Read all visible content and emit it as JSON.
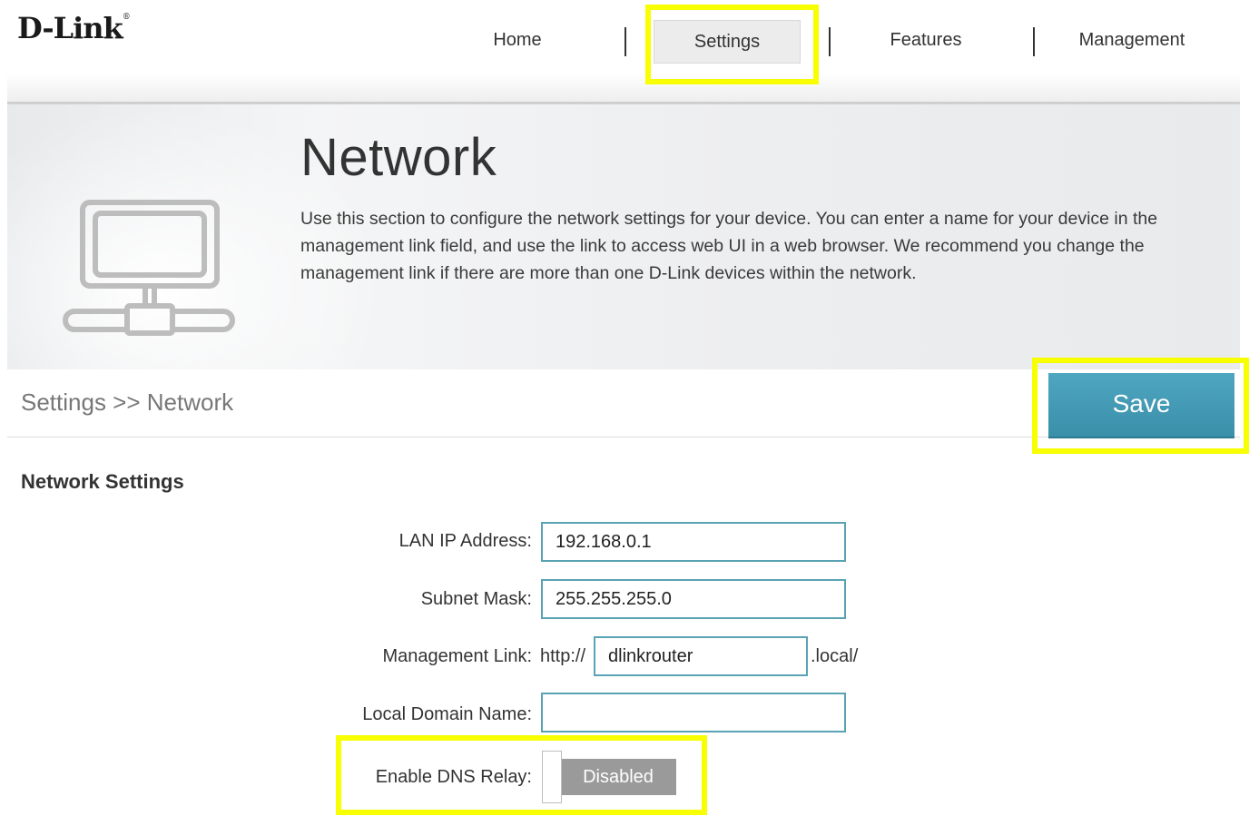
{
  "header": {
    "logo": "D-Link",
    "logo_mark": "®",
    "nav": {
      "home": "Home",
      "settings": "Settings",
      "features": "Features",
      "management": "Management"
    },
    "active_nav": "Settings"
  },
  "banner": {
    "title": "Network",
    "description": "Use this section to configure the network settings for your device. You can enter a name for your device in the management link field, and use the link to access web UI in a web browser. We recommend you change the management link if there are more than one D-Link devices within the network.",
    "icon": "monitor-network-icon"
  },
  "breadcrumb": "Settings >> Network",
  "save_label": "Save",
  "section_title": "Network Settings",
  "form": {
    "lan_ip_label": "LAN IP Address:",
    "lan_ip_value": "192.168.0.1",
    "subnet_label": "Subnet Mask:",
    "subnet_value": "255.255.255.0",
    "mgmt_label": "Management Link:",
    "mgmt_prefix": "http://",
    "mgmt_value": "dlinkrouter",
    "mgmt_suffix": ".local/",
    "domain_label": "Local Domain Name:",
    "domain_value": "",
    "dns_label": "Enable DNS Relay:",
    "dns_state": "Disabled"
  },
  "colors": {
    "accent": "#3d93ad",
    "highlight": "#f7ff00",
    "toggle_off": "#9a9a9a",
    "input_border": "#5aa3b5"
  }
}
